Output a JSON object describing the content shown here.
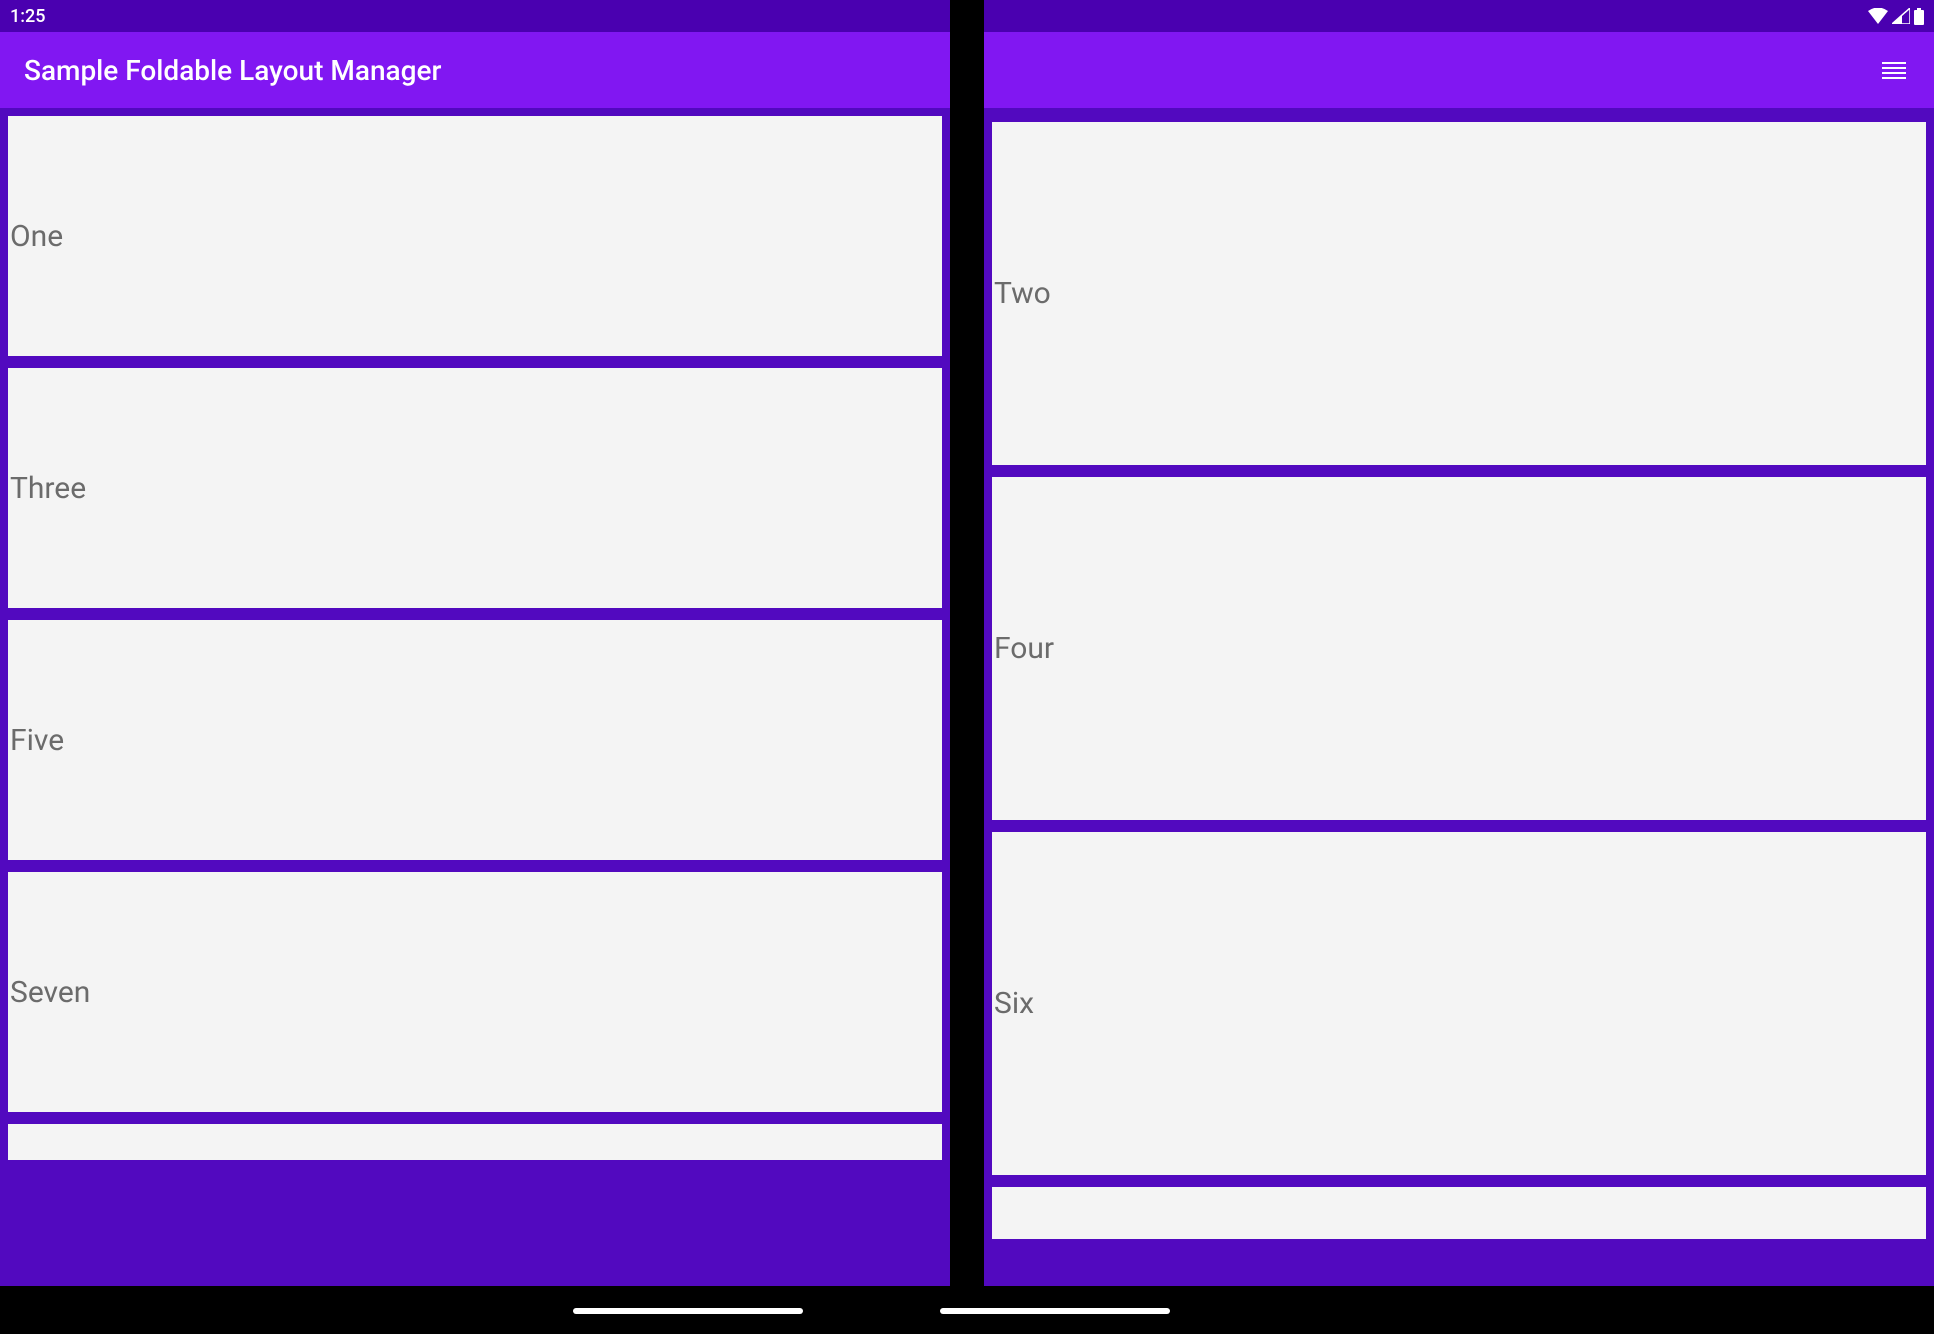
{
  "statusBar": {
    "time": "1:25"
  },
  "appBar": {
    "title": "Sample Foldable Layout Manager"
  },
  "leftPane": {
    "items": [
      {
        "label": "One"
      },
      {
        "label": "Three"
      },
      {
        "label": "Five"
      },
      {
        "label": "Seven"
      }
    ]
  },
  "rightPane": {
    "items": [
      {
        "label": "Two"
      },
      {
        "label": "Four"
      },
      {
        "label": "Six"
      }
    ]
  }
}
